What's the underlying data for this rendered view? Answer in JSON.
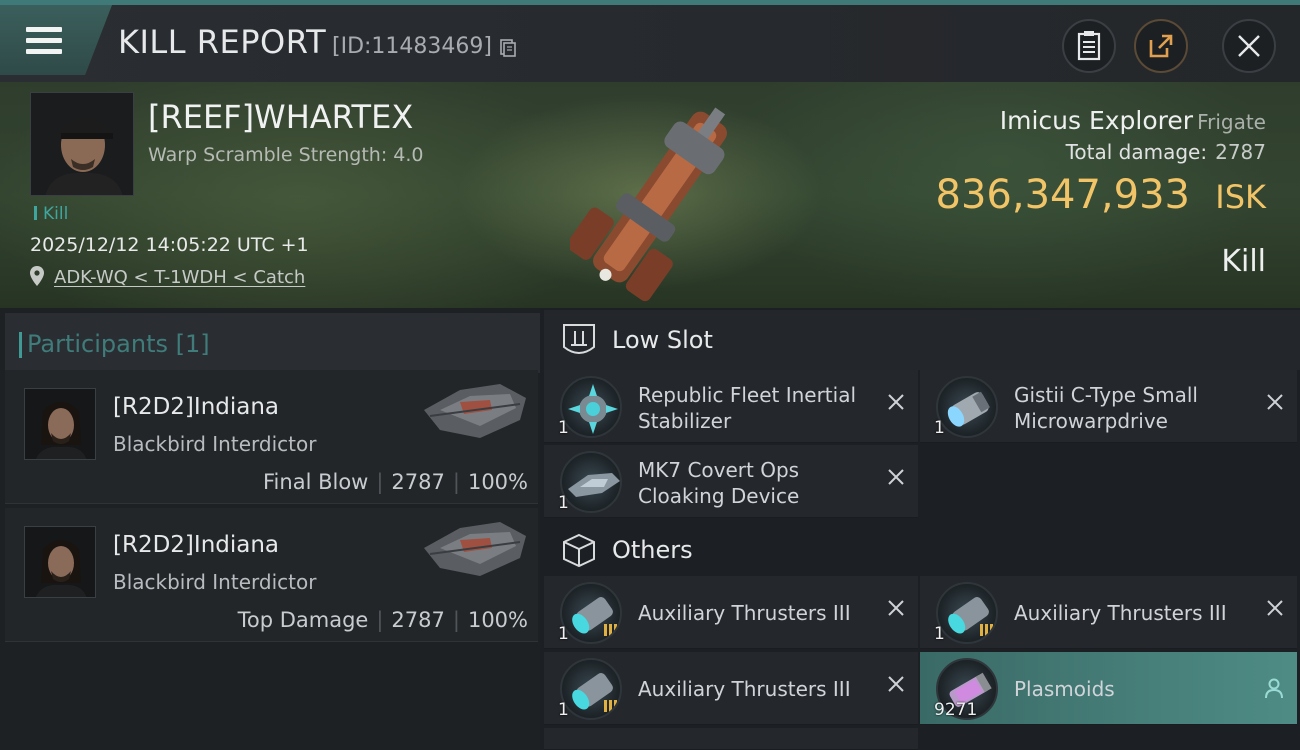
{
  "header": {
    "title": "KILL REPORT",
    "id": "[ID:11483469]"
  },
  "victim": {
    "name": "[REEF]WHARTEX",
    "stat": "Warp Scramble Strength: 4.0",
    "tag": "Kill",
    "datetime": "2025/12/12 14:05:22 UTC +1",
    "location": "ADK-WQ < T-1WDH < Catch",
    "ship_name": "Imicus Explorer",
    "ship_class": "Frigate",
    "total_damage_label": "Total damage:",
    "total_damage": "2787",
    "isk_value": "836,347,933",
    "isk_unit": "ISK",
    "result": "Kill"
  },
  "participants": {
    "title": "Participants [1]",
    "items": [
      {
        "name": "[R2D2]Indiana",
        "ship": "Blackbird Interdictor",
        "role": "Final Blow",
        "damage": "2787",
        "percent": "100%"
      },
      {
        "name": "[R2D2]Indiana",
        "ship": "Blackbird Interdictor",
        "role": "Top Damage",
        "damage": "2787",
        "percent": "100%"
      }
    ]
  },
  "sections": {
    "low_slot": {
      "title": "Low Slot",
      "items": [
        {
          "name": "Republic Fleet Inertial Stabilizer",
          "qty": "1",
          "icon": "inertial-stabilizer-icon"
        },
        {
          "name": "Gistii C-Type Small Microwarpdrive",
          "qty": "1",
          "icon": "microwarpdrive-icon"
        },
        {
          "name": "MK7 Covert Ops Cloaking Device",
          "qty": "1",
          "icon": "cloaking-device-icon"
        }
      ]
    },
    "others": {
      "title": "Others",
      "items": [
        {
          "name": "Auxiliary Thrusters III",
          "qty": "1",
          "icon": "auxiliary-thrusters-icon"
        },
        {
          "name": "Auxiliary Thrusters III",
          "qty": "1",
          "icon": "auxiliary-thrusters-icon"
        },
        {
          "name": "Auxiliary Thrusters III",
          "qty": "1",
          "icon": "auxiliary-thrusters-icon"
        },
        {
          "name": "Plasmoids",
          "qty": "9271",
          "icon": "plasmoids-icon"
        }
      ]
    }
  },
  "colors": {
    "accent_teal": "#3f9a96",
    "isk_gold": "#f2c468",
    "highlight_row": "#4f8c86"
  }
}
